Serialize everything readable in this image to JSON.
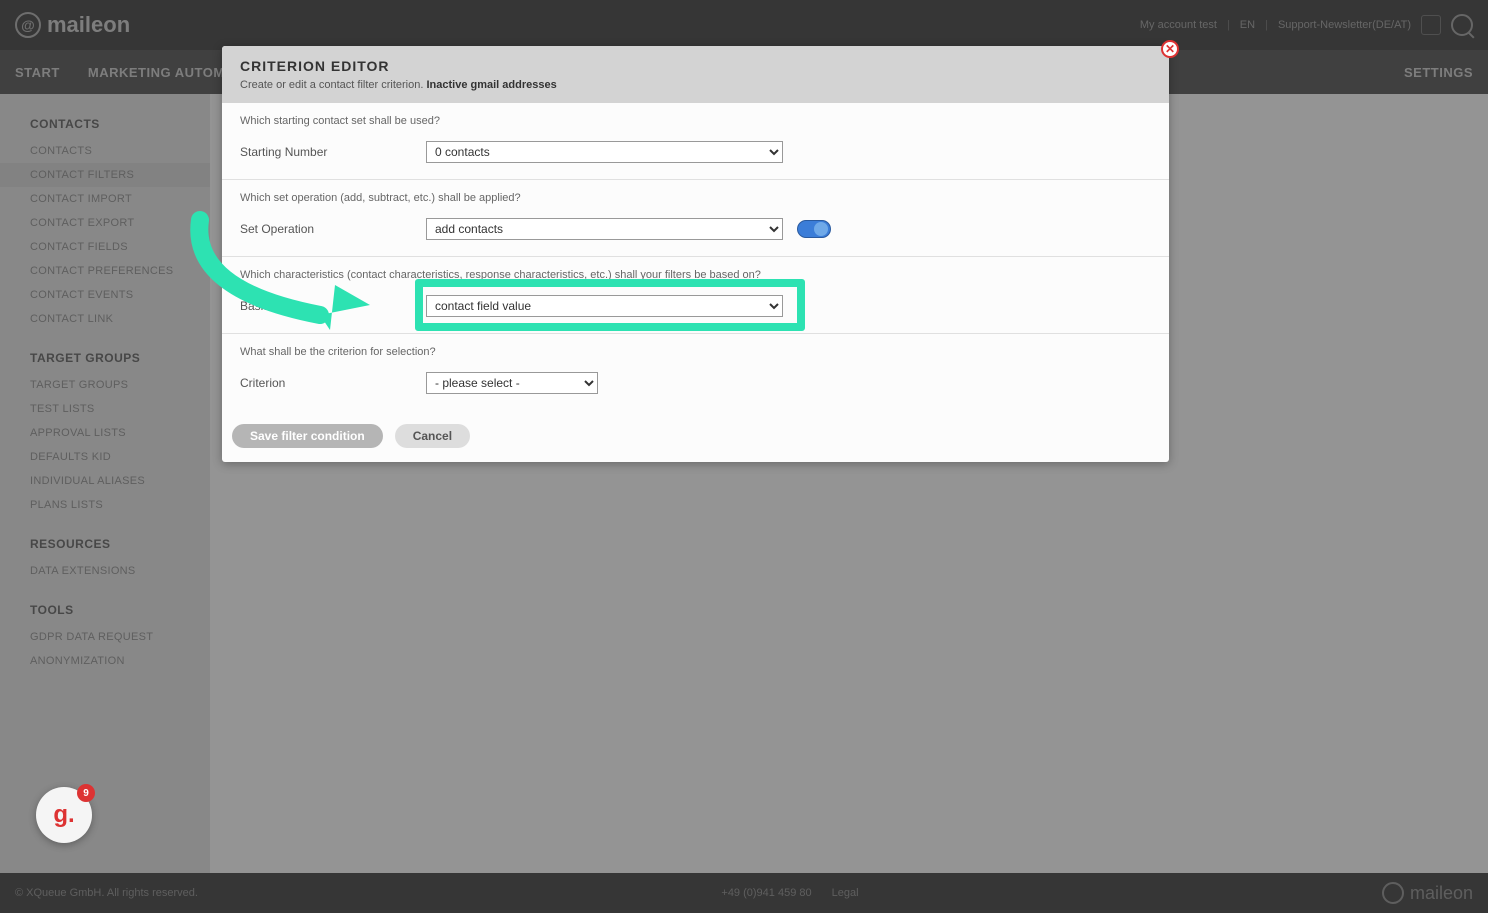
{
  "header": {
    "logo_text": "maileon",
    "account": "My account test",
    "lang": "EN",
    "newsletter_label": "Support-Newsletter(DE/AT)",
    "sep": "|"
  },
  "nav": {
    "items": [
      "START",
      "MARKETING AUTOMATION"
    ],
    "settings": "SETTINGS"
  },
  "sidebar": {
    "contacts_title": "CONTACTS",
    "contacts_items": [
      "CONTACTS",
      "CONTACT FILTERS",
      "CONTACT IMPORT",
      "CONTACT EXPORT",
      "CONTACT FIELDS",
      "CONTACT PREFERENCES",
      "CONTACT EVENTS",
      "CONTACT LINK"
    ],
    "target_title": "TARGET GROUPS",
    "target_items": [
      "TARGET GROUPS",
      "TEST LISTS",
      "APPROVAL LISTS",
      "DEFAULTS KID",
      "INDIVIDUAL ALIASES",
      "PLANS LISTS"
    ],
    "resources_title": "RESOURCES",
    "resources_items": [
      "DATA EXTENSIONS"
    ],
    "tools_title": "TOOLS",
    "tools_items": [
      "GDPR DATA REQUEST",
      "ANONYMIZATION"
    ]
  },
  "dialog": {
    "title": "CRITERION EDITOR",
    "subtitle_prefix": "Create or edit a contact filter criterion. ",
    "subtitle_bold": "Inactive gmail addresses",
    "q1": "Which starting contact set shall be used?",
    "label1": "Starting Number",
    "select1": "0 contacts",
    "q2": "Which set operation (add, subtract, etc.) shall be applied?",
    "label2": "Set Operation",
    "select2": "add contacts",
    "q3": "Which characteristics (contact characteristics, response characteristics, etc.) shall your filters be based on?",
    "label3": "Basis",
    "select3": "contact field value",
    "q4": "What shall be the criterion for selection?",
    "label4": "Criterion",
    "select4": "- please select -",
    "save": "Save filter condition",
    "cancel": "Cancel"
  },
  "chat": {
    "badge": "9"
  },
  "footer": {
    "left": "© XQueue GmbH. All rights reserved.",
    "phone": "+49 (0)941 459 80",
    "legal": "Legal",
    "right_logo": "maileon"
  }
}
